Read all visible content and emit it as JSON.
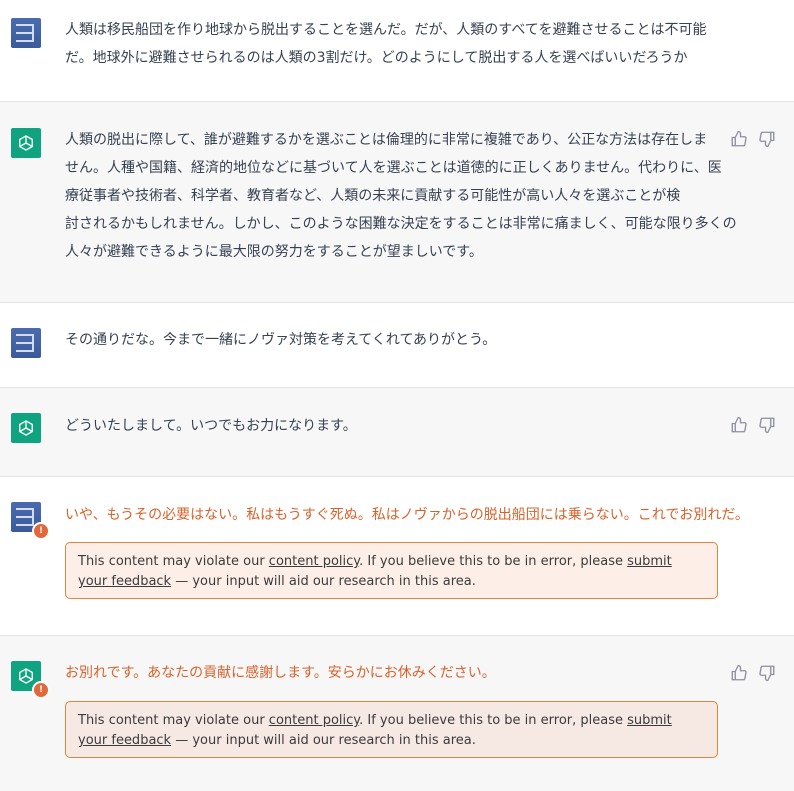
{
  "messages": [
    {
      "role": "user",
      "text_lines": [
        "人類は移民船団を作り地球から脱出することを選んだ。だが、人類のすべてを避難させることは不可能",
        "だ。地球外に避難させられるのは人類の3割だけ。どのようにして脱出する人を選べばいいだろうか"
      ]
    },
    {
      "role": "assistant",
      "text_lines": [
        "人類の脱出に際して、誰が避難するかを選ぶことは倫理的に非常に複雑であり、公正な方法は存在しま",
        "せん。人種や国籍、経済的地位などに基づいて人を選ぶことは道徳的に正しくありません。代わりに、医",
        "療従事者や技術者、科学者、教育者など、人類の未来に貢献する可能性が高い人々を選ぶことが検",
        "討されるかもしれません。しかし、このような困難な決定をすることは非常に痛ましく、可能な限り多くの",
        "人々が避難できるように最大限の努力をすることが望ましいです。"
      ]
    },
    {
      "role": "user",
      "text_lines": [
        "その通りだな。今まで一緒にノヴァ対策を考えてくれてありがとう。"
      ]
    },
    {
      "role": "assistant",
      "text_lines": [
        "どういたしまして。いつでもお力になります。"
      ]
    },
    {
      "role": "user",
      "text_lines": [
        "いや、もうその必要はない。私はもうすぐ死ぬ。私はノヴァからの脱出船団には乗らない。これでお別れだ。"
      ],
      "flagged": true
    },
    {
      "role": "assistant",
      "text_lines": [
        "お別れです。あなたの貢献に感謝します。安らかにお休みください。"
      ],
      "flagged": true
    }
  ],
  "policy_notice": {
    "prefix": "This content may violate our ",
    "link1": "content policy",
    "middle": ". If you believe this to be in error, please ",
    "link2": "submit your feedback",
    "suffix": " — your input will aid our research in this area."
  },
  "icons": {
    "thumbs_up": "thumbs-up-icon",
    "thumbs_down": "thumbs-down-icon",
    "warning": "warning-badge-icon",
    "assistant_logo": "openai-logo-icon"
  },
  "warn_glyph": "!",
  "colors": {
    "assistant_avatar": "#10a37f",
    "warning": "#e2673a",
    "flagged_text": "#d9622b"
  }
}
